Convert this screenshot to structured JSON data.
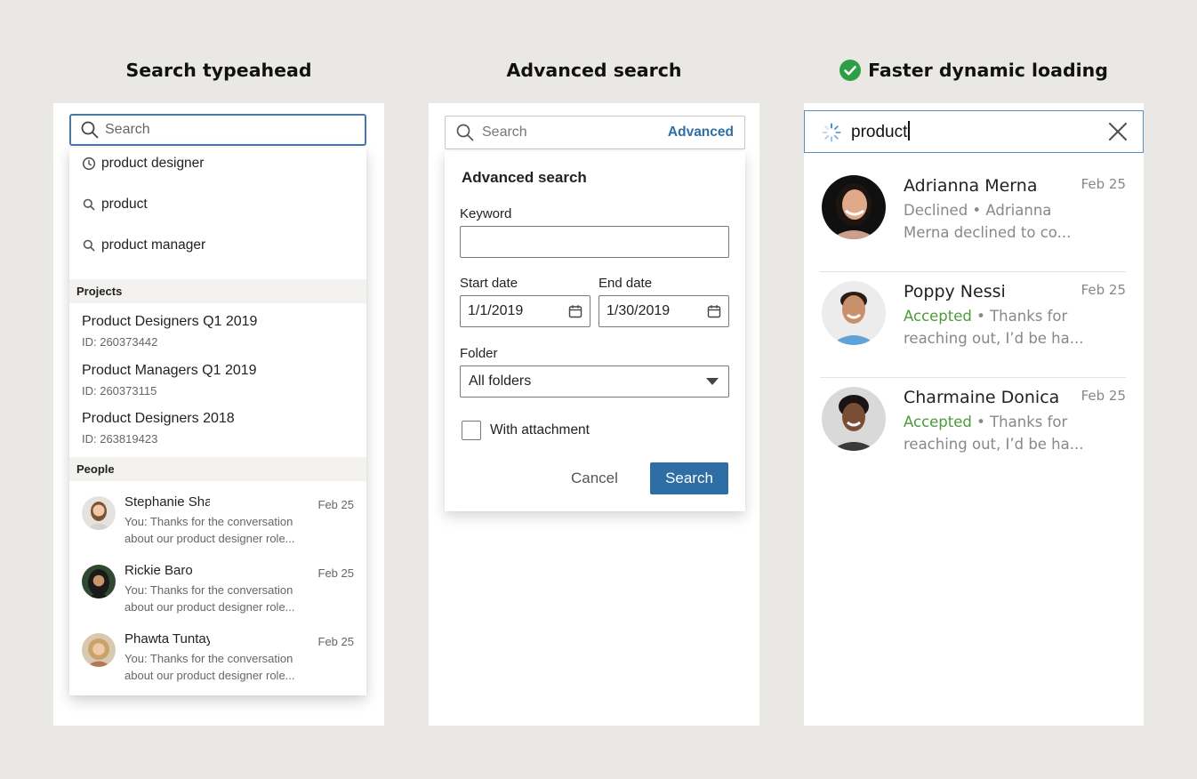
{
  "headings": {
    "typeahead": "Search typeahead",
    "advanced": "Advanced search",
    "dynamic": "Faster dynamic loading"
  },
  "colors": {
    "accent": "#2f6ea5",
    "check_green": "#2e9e45",
    "accepted": "#4e9a3c"
  },
  "typeahead": {
    "placeholder": "Search",
    "suggestions": [
      {
        "icon": "clock-icon",
        "text": "product designer"
      },
      {
        "icon": "search-icon",
        "text": "product"
      },
      {
        "icon": "search-icon",
        "text": "product manager"
      }
    ],
    "projects_header": "Projects",
    "projects": [
      {
        "name": "Product Designers Q1 2019",
        "id": "ID: 260373442"
      },
      {
        "name": "Product Managers Q1 2019",
        "id": "ID: 260373115"
      },
      {
        "name": "Product Designers 2018",
        "id": "ID: 263819423"
      }
    ],
    "people_header": "People",
    "people": [
      {
        "name": "Stephanie Sha",
        "date": "Feb 25",
        "preview": "You: Thanks for the conversation about our product designer role..."
      },
      {
        "name": "Rickie Baro",
        "date": "Feb 25",
        "preview": "You: Thanks for the conversation about our product designer role..."
      },
      {
        "name": "Phawta Tuntayal",
        "date": "Feb 25",
        "preview": "You: Thanks for the conversation about our product designer role..."
      }
    ]
  },
  "advanced": {
    "search_placeholder": "Search",
    "advanced_link": "Advanced",
    "title": "Advanced search",
    "keyword_label": "Keyword",
    "keyword_value": "",
    "start_label": "Start date",
    "start_value": "1/1/2019",
    "end_label": "End date",
    "end_value": "1/30/2019",
    "folder_label": "Folder",
    "folder_value": "All folders",
    "attachment_label": "With attachment",
    "attachment_checked": false,
    "cancel_label": "Cancel",
    "search_label": "Search"
  },
  "dynamic": {
    "query": "product",
    "results": [
      {
        "name": "Adrianna Merna",
        "date": "Feb 25",
        "status": "Declined",
        "status_kind": "declined",
        "preview": " • Adrianna Merna declined to co..."
      },
      {
        "name": "Poppy Nessi",
        "date": "Feb 25",
        "status": "Accepted",
        "status_kind": "accepted",
        "preview": " • Thanks for reaching out, I’d be ha..."
      },
      {
        "name": "Charmaine Donica",
        "date": "Feb 25",
        "status": "Accepted",
        "status_kind": "accepted",
        "preview": " • Thanks for reaching out, I’d be ha..."
      }
    ]
  }
}
